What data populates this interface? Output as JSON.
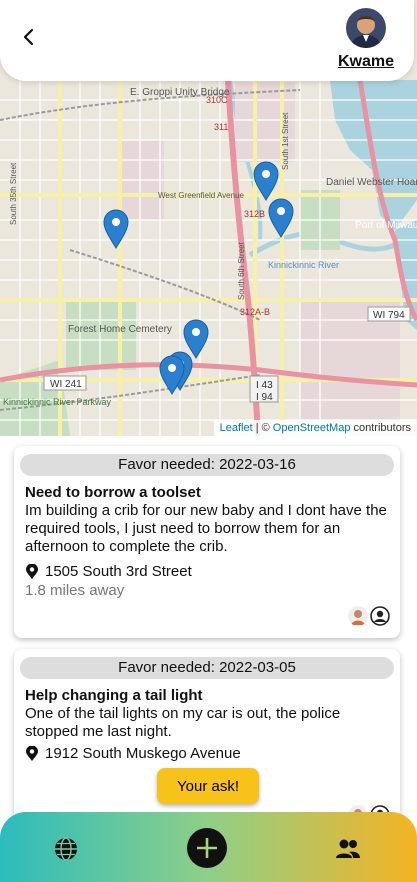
{
  "header": {
    "back_icon": "chevron-left-icon",
    "username": "Kwame"
  },
  "map": {
    "labels": {
      "bridge": "E. Groppi Unity Bridge",
      "street_greenfield": "West Greenfield Avenue",
      "cemetery": "Forest Home Cemetery",
      "hoan_bridge": "Daniel Webster Hoan Memorial Bridge",
      "port": "Port of Milwaukee",
      "river": "Kinnickinnic River",
      "parkway": "Kinnickinnic River Parkway",
      "hwy_241": "WI 241",
      "hwy_794": "WI 794",
      "hwy_43": "I 43",
      "hwy_94": "I 94",
      "hwy_310c": "310C",
      "hwy_311": "311",
      "hwy_312b": "312B",
      "hwy_312a": "312A-B",
      "street_6th": "South 6th Street",
      "street_1st": "South 1st Street",
      "street_35th": "South 35th Street"
    },
    "attribution": {
      "leaflet": "Leaflet",
      "sep": "| ©",
      "osm": "OpenStreetMap",
      "contributors": "contributors"
    }
  },
  "favors": [
    {
      "date_label": "Favor needed: 2022-03-16",
      "title": "Need to borrow a toolset",
      "description": "Im building a crib for our new baby and I dont have the required tools, I just need to borrow them for an afternoon to complete the crib.",
      "address": "1505 South 3rd Street",
      "distance": "1.8 miles away"
    },
    {
      "date_label": "Favor needed: 2022-03-05",
      "title": "Help changing a tail light",
      "description": "One of the tail lights on my car is out, the police stopped me last night.",
      "address": "1912 South Muskego Avenue",
      "ask_label": "Your ask!"
    }
  ],
  "nav": {
    "left_icon": "globe-icon",
    "center_icon": "add-circle-icon",
    "right_icon": "people-icon"
  },
  "colors": {
    "ask_button": "#f7c219",
    "pin": "#2a7fcf",
    "nav_gradient_start": "#2cbcbd",
    "nav_gradient_end": "#f5b324"
  }
}
